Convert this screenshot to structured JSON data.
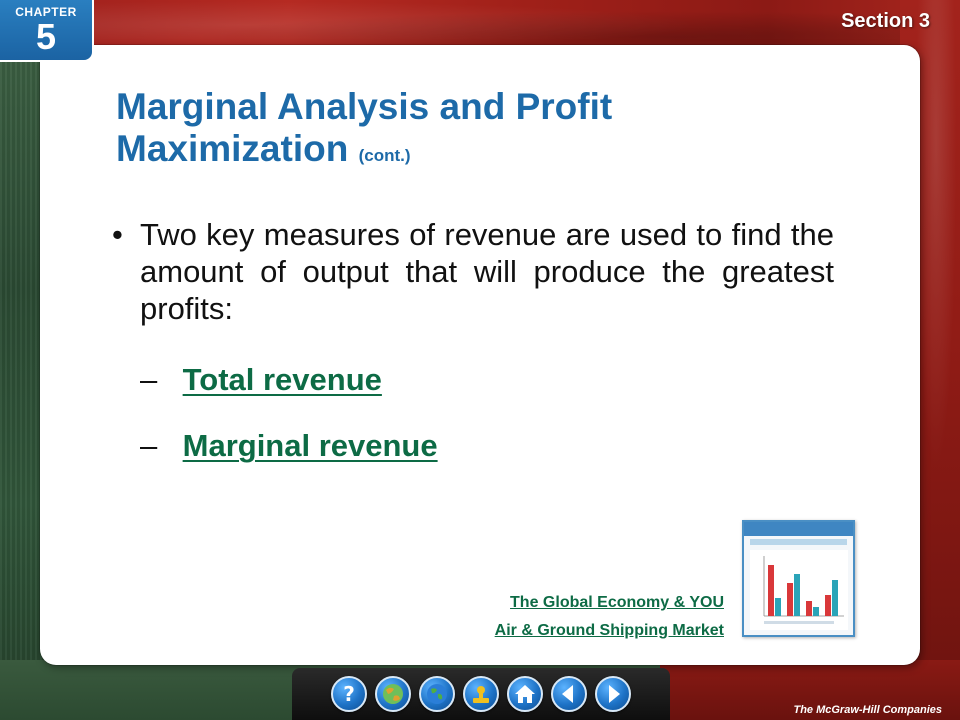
{
  "header": {
    "chapter_label": "CHAPTER",
    "chapter_number": "5",
    "section_label": "Section 3"
  },
  "slide": {
    "title_main": "Marginal Analysis and Profit Maximization",
    "title_cont": "(cont.)",
    "bullet_symbol": "•",
    "bullet_text": "Two key measures of revenue are used to find the amount of output that will produce the greatest profits:",
    "subitems": [
      {
        "dash": "–",
        "label": "Total revenue"
      },
      {
        "dash": "–",
        "label": "Marginal revenue"
      }
    ]
  },
  "feature_link": {
    "line1": "The Global Economy & YOU",
    "line2": "Air & Ground Shipping Market"
  },
  "thumbnail": {
    "icon": "global-economy-feature-thumbnail",
    "chart_data": {
      "type": "bar",
      "series": [
        {
          "color": "#d9383a",
          "values": [
            0.85,
            0.55,
            0.25,
            0.35
          ]
        },
        {
          "color": "#2aa4b8",
          "values": [
            0.3,
            0.7,
            0.15,
            0.6
          ]
        }
      ]
    }
  },
  "nav": {
    "buttons": [
      {
        "name": "help-button",
        "icon": "question-mark-icon"
      },
      {
        "name": "chapter-resources-button",
        "icon": "globe-map-icon"
      },
      {
        "name": "global-economy-button",
        "icon": "world-globe-icon"
      },
      {
        "name": "transparency-button",
        "icon": "stamp-icon"
      },
      {
        "name": "home-button",
        "icon": "home-icon"
      },
      {
        "name": "previous-button",
        "icon": "arrow-left-icon"
      },
      {
        "name": "next-button",
        "icon": "arrow-right-icon"
      }
    ]
  },
  "footer": {
    "publisher": "The McGraw-Hill Companies"
  },
  "colors": {
    "title": "#1d6aa8",
    "link": "#0d6b45",
    "chapter_tab": "#1b63a3",
    "frame_red": "#a3231c",
    "frame_green": "#2e4a35"
  }
}
